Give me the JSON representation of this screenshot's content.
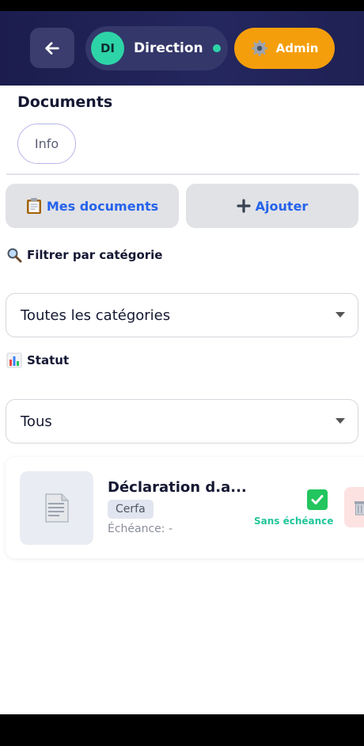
{
  "header": {
    "avatar_initials": "DI",
    "user_label": "Direction",
    "online_color": "#2dd4a7",
    "admin_label": "Admin",
    "admin_color": "#f59e0b"
  },
  "page": {
    "title": "Documents",
    "tabs": [
      {
        "label": "Info"
      }
    ]
  },
  "actions": {
    "my_documents_label": "Mes documents",
    "add_label": "Ajouter"
  },
  "filters": {
    "category_label": "Filtrer par catégorie",
    "category_value": "Toutes les catégories",
    "status_label": "Statut",
    "status_value": "Tous"
  },
  "documents": [
    {
      "name": "Déclaration d.a...",
      "tag": "Cerfa",
      "due": "Échéance: -",
      "status": "Sans échéance"
    }
  ],
  "icons": [
    "arrow-left-icon",
    "gear-icon",
    "clipboard-icon",
    "plus-icon",
    "magnifier-icon",
    "bar-chart-icon",
    "chevron-down-icon",
    "document-icon",
    "checkmark-icon",
    "trash-icon"
  ]
}
